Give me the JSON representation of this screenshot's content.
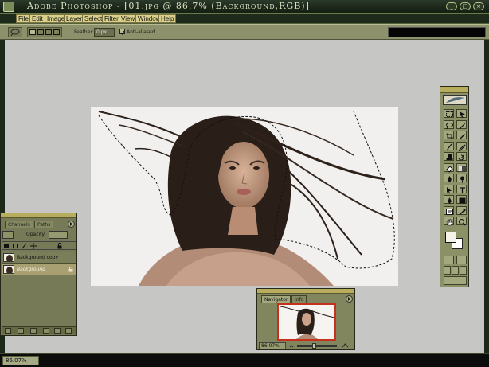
{
  "window": {
    "title": "Adobe Photoshop - [01.jpg @ 86.7% (Background,RGB)]",
    "buttons": [
      "_",
      "□",
      "×"
    ]
  },
  "menu": [
    "File",
    "Edit",
    "Image",
    "Layer",
    "Select",
    "Filter",
    "View",
    "Window",
    "Help"
  ],
  "options": {
    "feather_label": "Feather:",
    "feather_value": "0 px",
    "antialiased_label": "Anti-aliased",
    "antialiased_checked": true
  },
  "layers_panel": {
    "tabs": [
      "Channels",
      "Paths"
    ],
    "opacity_label": "Opacity:",
    "layers": [
      {
        "name": "Background copy",
        "active": false
      },
      {
        "name": "Background",
        "active": true
      }
    ]
  },
  "navigator": {
    "tabs": [
      "Navigator",
      "Info"
    ],
    "zoom": "86.07%"
  },
  "status": {
    "zoom": "86.07%"
  },
  "colors": {
    "frame": "#1d2819",
    "panel": "#767a56",
    "panel_head": "#b7ad5c",
    "menu_item": "#d9d18b",
    "workspace": "#c6c6c4",
    "nav_box": "#c4321f"
  },
  "icons": {
    "tools": [
      "marquee-icon",
      "move-icon",
      "lasso-icon",
      "magic-wand-icon",
      "crop-icon",
      "slice-icon",
      "brush-icon",
      "pencil-icon",
      "stamp-icon",
      "history-brush-icon",
      "eraser-icon",
      "gradient-icon",
      "blur-icon",
      "dodge-icon",
      "path-select-icon",
      "type-icon",
      "pen-icon",
      "shape-icon",
      "notes-icon",
      "eyedropper-icon",
      "hand-icon",
      "zoom-icon"
    ]
  }
}
